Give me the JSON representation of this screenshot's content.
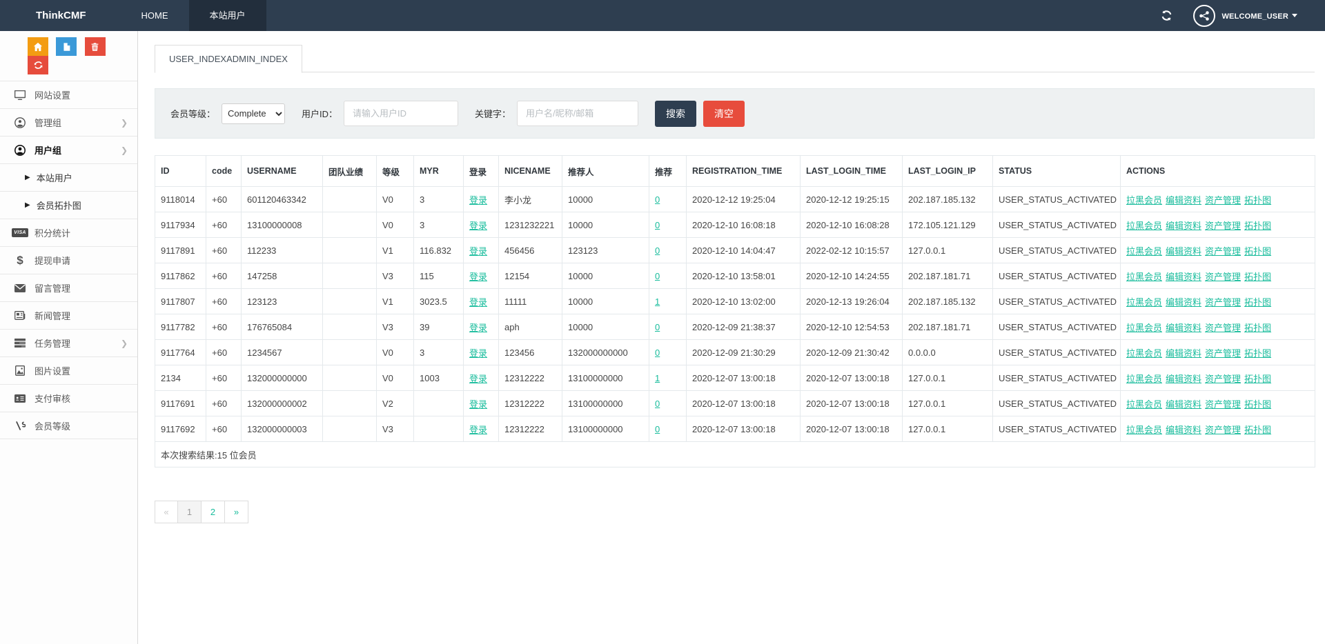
{
  "navbar": {
    "brand": "ThinkCMF",
    "items": [
      {
        "label": "HOME",
        "active": false
      },
      {
        "label": "本站用户",
        "active": true
      }
    ],
    "welcome": "WELCOME_USER"
  },
  "sidebar": {
    "quick_buttons": [
      {
        "name": "home",
        "color": "#f39c12"
      },
      {
        "name": "file",
        "color": "#3a99d8"
      },
      {
        "name": "trash",
        "color": "#e64c3c"
      },
      {
        "name": "recycle",
        "color": "#e64c3c"
      }
    ],
    "items": [
      {
        "label": "网站设置",
        "icon": "monitor-icon"
      },
      {
        "label": "管理组",
        "icon": "admin-group-icon",
        "chevron": true
      },
      {
        "label": "用户组",
        "icon": "user-group-icon",
        "chevron": true,
        "active": true
      },
      {
        "label": "本站用户",
        "submenu": true
      },
      {
        "label": "会员拓扑图",
        "submenu": true
      },
      {
        "label": "积分统计",
        "icon": "visa-icon"
      },
      {
        "label": "提现申请",
        "icon": "dollar-icon"
      },
      {
        "label": "留言管理",
        "icon": "envelope-icon"
      },
      {
        "label": "新闻管理",
        "icon": "newspaper-icon"
      },
      {
        "label": "任务管理",
        "icon": "tasks-icon",
        "chevron": true
      },
      {
        "label": "图片设置",
        "icon": "image-icon"
      },
      {
        "label": "支付审核",
        "icon": "id-card-icon"
      },
      {
        "label": "会员等级",
        "icon": "level-route-icon"
      }
    ]
  },
  "tab": {
    "label": "USER_INDEXADMIN_INDEX"
  },
  "filter": {
    "level_label": "会员等级：",
    "level_value": "Complete",
    "userid_label": "用户ID：",
    "userid_placeholder": "请输入用户ID",
    "keyword_label": "关键字：",
    "keyword_placeholder": "用户名/昵称/邮箱",
    "search_button": "搜索",
    "clear_button": "清空"
  },
  "table": {
    "headers": [
      "ID",
      "code",
      "USERNAME",
      "团队业绩",
      "等级",
      "MYR",
      "登录",
      "NICENAME",
      "推荐人",
      "推荐",
      "REGISTRATION_TIME",
      "LAST_LOGIN_TIME",
      "LAST_LOGIN_IP",
      "STATUS",
      "ACTIONS"
    ],
    "login_link": "登录",
    "actions": [
      "拉黑会员",
      "编辑资料",
      "资产管理",
      "拓扑图"
    ],
    "rows": [
      {
        "id": "9118014",
        "code": "+60",
        "username": "601120463342",
        "team": "",
        "level": "V0",
        "myr": "3",
        "nicename": "李小龙",
        "referrer": "10000",
        "ref": "0",
        "reg_time": "2020-12-12 19:25:04",
        "last_login_time": "2020-12-12 19:25:15",
        "last_login_ip": "202.187.185.132",
        "status": "USER_STATUS_ACTIVATED"
      },
      {
        "id": "9117934",
        "code": "+60",
        "username": "13100000008",
        "team": "",
        "level": "V0",
        "myr": "3",
        "nicename": "1231232221",
        "referrer": "10000",
        "ref": "0",
        "reg_time": "2020-12-10 16:08:18",
        "last_login_time": "2020-12-10 16:08:28",
        "last_login_ip": "172.105.121.129",
        "status": "USER_STATUS_ACTIVATED"
      },
      {
        "id": "9117891",
        "code": "+60",
        "username": "112233",
        "team": "",
        "level": "V1",
        "myr": "116.832",
        "nicename": "456456",
        "referrer": "123123",
        "ref": "0",
        "reg_time": "2020-12-10 14:04:47",
        "last_login_time": "2022-02-12 10:15:57",
        "last_login_ip": "127.0.0.1",
        "status": "USER_STATUS_ACTIVATED"
      },
      {
        "id": "9117862",
        "code": "+60",
        "username": "147258",
        "team": "",
        "level": "V3",
        "myr": "115",
        "nicename": "12154",
        "referrer": "10000",
        "ref": "0",
        "reg_time": "2020-12-10 13:58:01",
        "last_login_time": "2020-12-10 14:24:55",
        "last_login_ip": "202.187.181.71",
        "status": "USER_STATUS_ACTIVATED"
      },
      {
        "id": "9117807",
        "code": "+60",
        "username": "123123",
        "team": "",
        "level": "V1",
        "myr": "3023.5",
        "nicename": "11111",
        "referrer": "10000",
        "ref": "1",
        "reg_time": "2020-12-10 13:02:00",
        "last_login_time": "2020-12-13 19:26:04",
        "last_login_ip": "202.187.185.132",
        "status": "USER_STATUS_ACTIVATED"
      },
      {
        "id": "9117782",
        "code": "+60",
        "username": "176765084",
        "team": "",
        "level": "V3",
        "myr": "39",
        "nicename": "aph",
        "referrer": "10000",
        "ref": "0",
        "reg_time": "2020-12-09 21:38:37",
        "last_login_time": "2020-12-10 12:54:53",
        "last_login_ip": "202.187.181.71",
        "status": "USER_STATUS_ACTIVATED"
      },
      {
        "id": "9117764",
        "code": "+60",
        "username": "1234567",
        "team": "",
        "level": "V0",
        "myr": "3",
        "nicename": "123456",
        "referrer": "132000000000",
        "ref": "0",
        "reg_time": "2020-12-09 21:30:29",
        "last_login_time": "2020-12-09 21:30:42",
        "last_login_ip": "0.0.0.0",
        "status": "USER_STATUS_ACTIVATED"
      },
      {
        "id": "2134",
        "code": "+60",
        "username": "132000000000",
        "team": "",
        "level": "V0",
        "myr": "1003",
        "nicename": "12312222",
        "referrer": "13100000000",
        "ref": "1",
        "reg_time": "2020-12-07 13:00:18",
        "last_login_time": "2020-12-07 13:00:18",
        "last_login_ip": "127.0.0.1",
        "status": "USER_STATUS_ACTIVATED"
      },
      {
        "id": "9117691",
        "code": "+60",
        "username": "132000000002",
        "team": "",
        "level": "V2",
        "myr": "",
        "nicename": "12312222",
        "referrer": "13100000000",
        "ref": "0",
        "reg_time": "2020-12-07 13:00:18",
        "last_login_time": "2020-12-07 13:00:18",
        "last_login_ip": "127.0.0.1",
        "status": "USER_STATUS_ACTIVATED"
      },
      {
        "id": "9117692",
        "code": "+60",
        "username": "132000000003",
        "team": "",
        "level": "V3",
        "myr": "",
        "nicename": "12312222",
        "referrer": "13100000000",
        "ref": "0",
        "reg_time": "2020-12-07 13:00:18",
        "last_login_time": "2020-12-07 13:00:18",
        "last_login_ip": "127.0.0.1",
        "status": "USER_STATUS_ACTIVATED"
      }
    ],
    "footer": "本次搜索结果:15 位会员"
  },
  "pagination": [
    {
      "label": "«",
      "state": "disabled"
    },
    {
      "label": "1",
      "state": "current"
    },
    {
      "label": "2",
      "state": "link"
    },
    {
      "label": "»",
      "state": "link"
    }
  ],
  "colors": {
    "navbar": "#2e3e50",
    "navbar_active": "#222e3c",
    "accent_teal": "#18bc9c",
    "danger_red": "#e74c3c",
    "info_blue": "#3a99d8",
    "warning_orange": "#f39c12"
  }
}
